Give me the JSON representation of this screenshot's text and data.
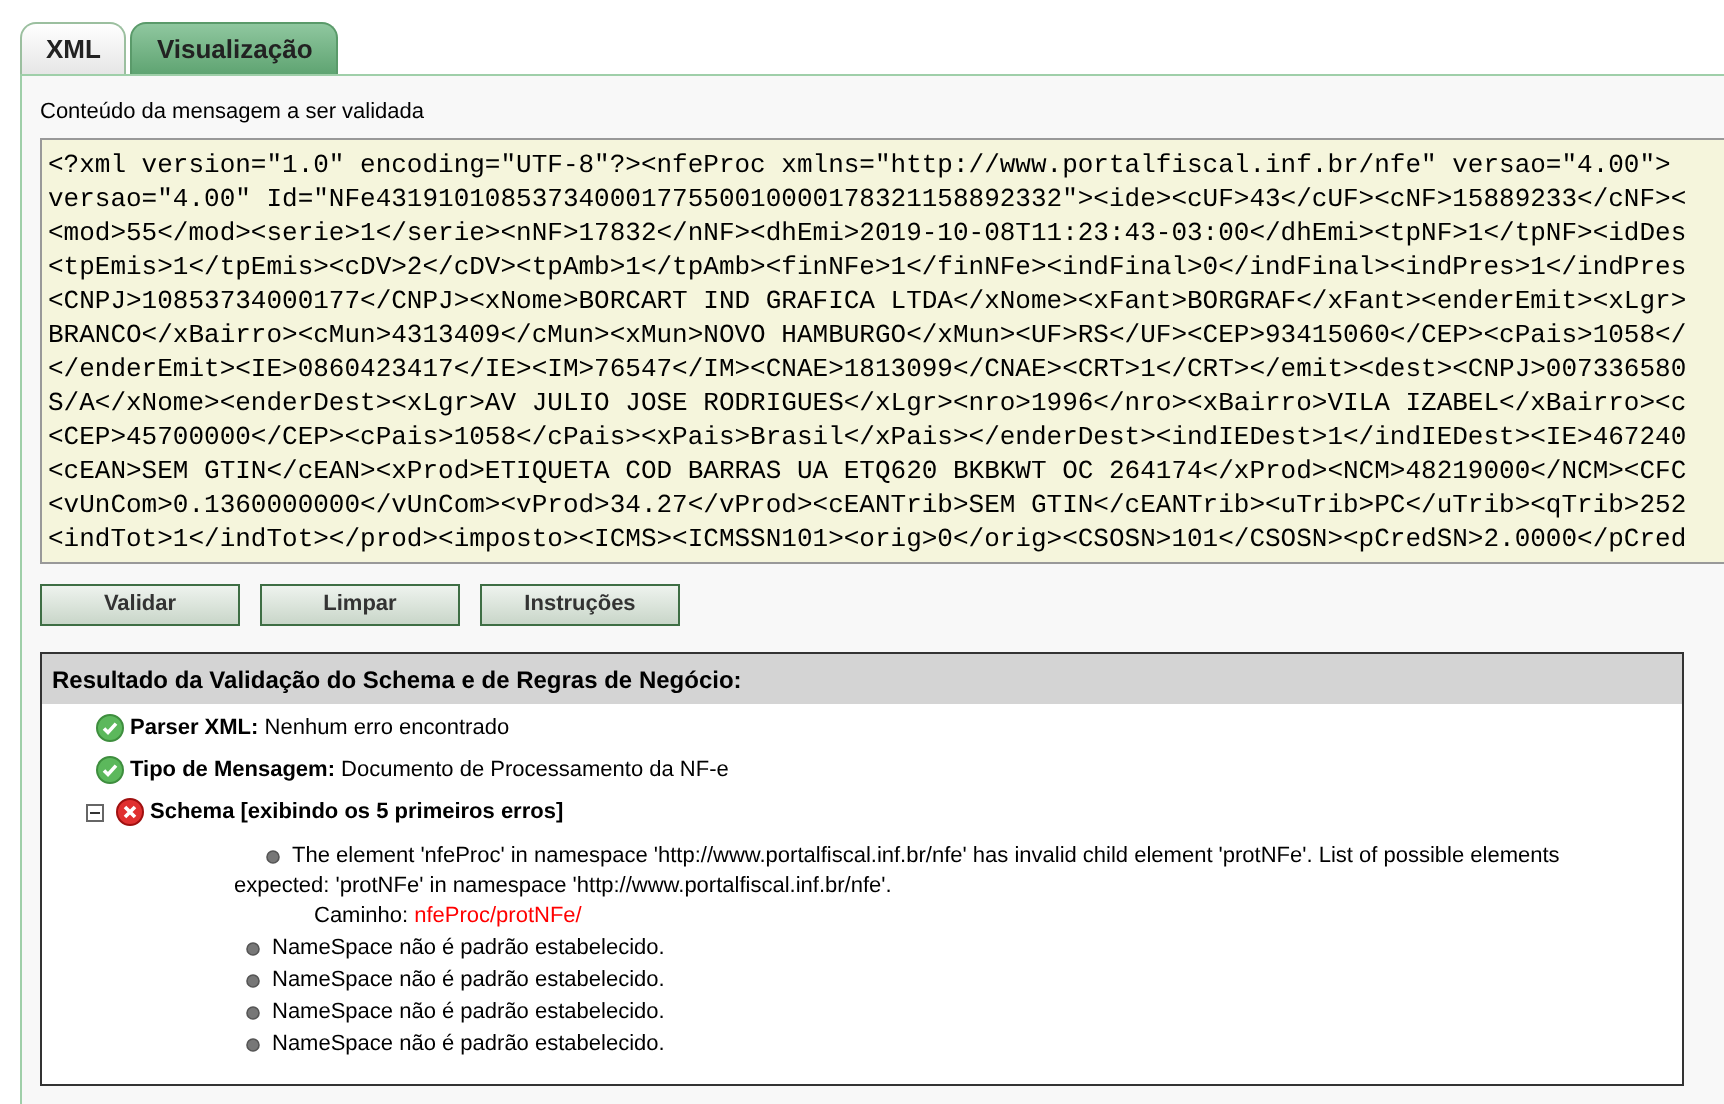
{
  "tabs": [
    {
      "label": "XML",
      "selected": false
    },
    {
      "label": "Visualização",
      "selected": true
    }
  ],
  "message_label": "Conteúdo da mensagem a ser validada",
  "xml_lines": [
    "<?xml version=\"1.0\" encoding=\"UTF-8\"?><nfeProc xmlns=\"http://www.portalfiscal.inf.br/nfe\" versao=\"4.00\">",
    "versao=\"4.00\" Id=\"NFe43191010853734000177550010000178321158892332\"><ide><cUF>43</cUF><cNF>15889233</cNF><",
    "<mod>55</mod><serie>1</serie><nNF>17832</nNF><dhEmi>2019-10-08T11:23:43-03:00</dhEmi><tpNF>1</tpNF><idDes",
    "<tpEmis>1</tpEmis><cDV>2</cDV><tpAmb>1</tpAmb><finNFe>1</finNFe><indFinal>0</indFinal><indPres>1</indPres",
    "<CNPJ>10853734000177</CNPJ><xNome>BORCART IND GRAFICA LTDA</xNome><xFant>BORGRAF</xFant><enderEmit><xLgr>",
    "BRANCO</xBairro><cMun>4313409</cMun><xMun>NOVO HAMBURGO</xMun><UF>RS</UF><CEP>93415060</CEP><cPais>1058</",
    "</enderEmit><IE>0860423417</IE><IM>76547</IM><CNAE>1813099</CNAE><CRT>1</CRT></emit><dest><CNPJ>007336580",
    "S/A</xNome><enderDest><xLgr>AV JULIO JOSE RODRIGUES</xLgr><nro>1996</nro><xBairro>VILA IZABEL</xBairro><c",
    "<CEP>45700000</CEP><cPais>1058</cPais><xPais>Brasil</xPais></enderDest><indIEDest>1</indIEDest><IE>467240",
    "<cEAN>SEM GTIN</cEAN><xProd>ETIQUETA COD BARRAS UA ETQ620 BKBKWT OC 264174</xProd><NCM>48219000</NCM><CFC",
    "<vUnCom>0.1360000000</vUnCom><vProd>34.27</vProd><cEANTrib>SEM GTIN</cEANTrib><uTrib>PC</uTrib><qTrib>252",
    "<indTot>1</indTot></prod><imposto><ICMS><ICMSSN101><orig>0</orig><CSOSN>101</CSOSN><pCredSN>2.0000</pCred"
  ],
  "buttons": [
    "Validar",
    "Limpar",
    "Instruções"
  ],
  "result": {
    "title": "Resultado da Validação do Schema e de Regras de Negócio:",
    "items": [
      {
        "kind": "ok",
        "label": "Parser XML:",
        "text": "Nenhum erro encontrado"
      },
      {
        "kind": "ok",
        "label": "Tipo de Mensagem:",
        "text": "Documento de Processamento da NF-e"
      },
      {
        "kind": "error",
        "label": "Schema [exibindo os 5 primeiros erros]",
        "expanded": true,
        "errors": [
          {
            "message": "The element 'nfeProc' in namespace 'http://www.portalfiscal.inf.br/nfe' has invalid child element 'protNFe'. List of possible elements expected: 'protNFe' in namespace 'http://www.portalfiscal.inf.br/nfe'.",
            "path_label": "Caminho:",
            "path": "nfeProc/protNFe/"
          },
          {
            "message": "NameSpace não é padrão estabelecido."
          },
          {
            "message": "NameSpace não é padrão estabelecido."
          },
          {
            "message": "NameSpace não é padrão estabelecido."
          },
          {
            "message": "NameSpace não é padrão estabelecido."
          }
        ]
      }
    ]
  }
}
